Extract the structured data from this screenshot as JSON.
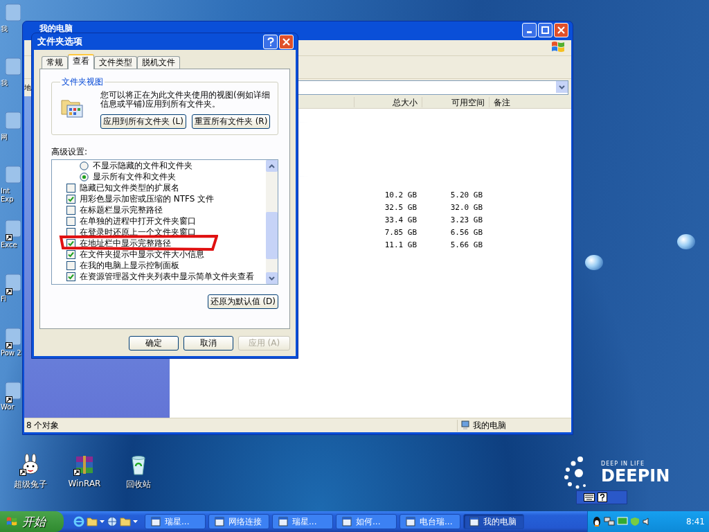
{
  "desktop_icons_left": [
    {
      "label": "我",
      "shortcut": false
    },
    {
      "label": "我",
      "shortcut": false
    },
    {
      "label": "网",
      "shortcut": false
    },
    {
      "label": "Int Exp",
      "shortcut": false
    },
    {
      "label": "Exce",
      "shortcut": true
    },
    {
      "label": "Fi",
      "shortcut": true
    },
    {
      "label": "Pow 2",
      "shortcut": true
    },
    {
      "label": "Wor",
      "shortcut": true
    }
  ],
  "explorer": {
    "title": "我的电脑",
    "address_label": "地",
    "columns": [
      {
        "label": "总大小"
      },
      {
        "label": "可用空间"
      },
      {
        "label": "备注"
      }
    ],
    "rows": [
      {
        "total_size": "10.2 GB",
        "free_space": "5.20 GB"
      },
      {
        "total_size": "32.5 GB",
        "free_space": "32.0 GB"
      },
      {
        "total_size": "33.4 GB",
        "free_space": "3.23 GB"
      },
      {
        "total_size": "7.85 GB",
        "free_space": "6.56 GB"
      },
      {
        "total_size": "11.1 GB",
        "free_space": "5.66 GB"
      }
    ],
    "status_count": "8 个对象",
    "status_location": "我的电脑"
  },
  "dialog": {
    "title": "文件夹选项",
    "tabs": [
      {
        "label": "常规",
        "selected": false
      },
      {
        "label": "查看",
        "selected": true
      },
      {
        "label": "文件类型",
        "selected": false
      },
      {
        "label": "脱机文件",
        "selected": false
      }
    ],
    "group_title": "文件夹视图",
    "description": "您可以将正在为此文件夹使用的视图(例如详细信息或平铺)应用到所有文件夹。",
    "view_buttons": [
      "应用到所有文件夹 (L)",
      "重置所有文件夹 (R)"
    ],
    "advanced_label": "高级设置:",
    "settings": [
      {
        "kind": "radio",
        "label": "不显示隐藏的文件和文件夹",
        "checked": false,
        "annotated": false
      },
      {
        "kind": "radio",
        "label": "显示所有文件和文件夹",
        "checked": true,
        "annotated": false
      },
      {
        "kind": "checkbox",
        "label": "隐藏已知文件类型的扩展名",
        "checked": false,
        "annotated": false
      },
      {
        "kind": "checkbox",
        "label": "用彩色显示加密或压缩的 NTFS 文件",
        "checked": true,
        "annotated": false
      },
      {
        "kind": "checkbox",
        "label": "在标题栏显示完整路径",
        "checked": false,
        "annotated": false
      },
      {
        "kind": "checkbox",
        "label": "在单独的进程中打开文件夹窗口",
        "checked": false,
        "annotated": false
      },
      {
        "kind": "checkbox",
        "label": "在登录时还原上一个文件夹窗口",
        "checked": false,
        "annotated": false
      },
      {
        "kind": "checkbox",
        "label": "在地址栏中显示完整路径",
        "checked": true,
        "annotated": true
      },
      {
        "kind": "checkbox",
        "label": "在文件夹提示中显示文件大小信息",
        "checked": true,
        "annotated": false
      },
      {
        "kind": "checkbox",
        "label": "在我的电脑上显示控制面板",
        "checked": false,
        "annotated": false
      },
      {
        "kind": "checkbox",
        "label": "在资源管理器文件夹列表中显示简单文件夹查看",
        "checked": true,
        "annotated": false
      }
    ],
    "restore_button": "还原为默认值 (D)",
    "buttons": [
      {
        "label": "确定",
        "disabled": false
      },
      {
        "label": "取消",
        "disabled": false
      },
      {
        "label": "应用 (A)",
        "disabled": true
      }
    ]
  },
  "desktop_icons_bottom": [
    {
      "kind": "rabbit",
      "label": "超级兔子",
      "shortcut": true
    },
    {
      "kind": "archive",
      "label": "WinRAR",
      "shortcut": true
    },
    {
      "kind": "recycle_bin",
      "label": "回收站",
      "shortcut": false
    }
  ],
  "logo": {
    "tagline": "DEEP IN LIFE",
    "name": "DEEPIN"
  },
  "taskbar": {
    "start": "开始",
    "tasks": [
      {
        "label": "瑞星...",
        "selected": false
      },
      {
        "label": "网络连接",
        "selected": false
      },
      {
        "label": "瑞星...",
        "selected": false
      },
      {
        "label": "如何...",
        "selected": false
      },
      {
        "label": "电台瑞...",
        "selected": false
      },
      {
        "label": "我的电脑",
        "selected": true
      }
    ],
    "clock": "8:41"
  }
}
